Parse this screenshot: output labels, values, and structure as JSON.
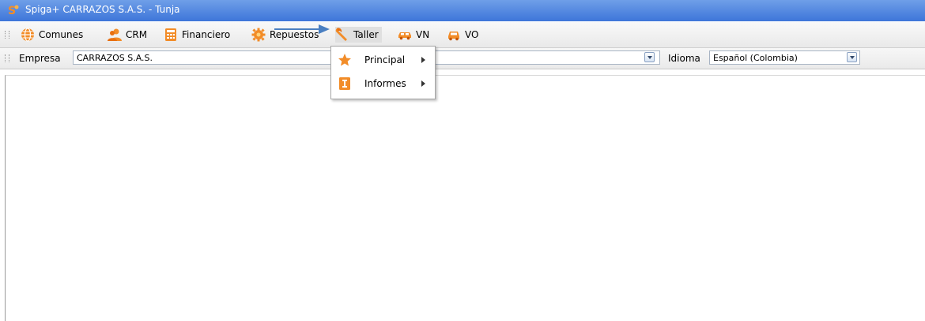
{
  "window": {
    "title": "Spiga+ CARRAZOS S.A.S. - Tunja"
  },
  "menubar": {
    "items": [
      {
        "label": "Comunes",
        "icon": "globe-icon"
      },
      {
        "label": "CRM",
        "icon": "users-icon"
      },
      {
        "label": "Financiero",
        "icon": "calculator-icon"
      },
      {
        "label": "Repuestos",
        "icon": "gear-icon"
      },
      {
        "label": "Taller",
        "icon": "wrench-icon"
      },
      {
        "label": "VN",
        "icon": "new-car-icon"
      },
      {
        "label": "VO",
        "icon": "used-car-icon"
      }
    ]
  },
  "toolbar": {
    "empresa_label": "Empresa",
    "empresa_value": "CARRAZOS S.A.S.",
    "idioma_label": "Idioma",
    "idioma_value": "Español (Colombia)"
  },
  "taller_menu": {
    "items": [
      {
        "label": "Principal",
        "icon": "star-icon"
      },
      {
        "label": "Informes",
        "icon": "report-icon"
      }
    ]
  },
  "colors": {
    "titlebar": "#3d75d9",
    "accent_orange": "#f07c1a",
    "pointer_blue": "#4a7fc1"
  }
}
